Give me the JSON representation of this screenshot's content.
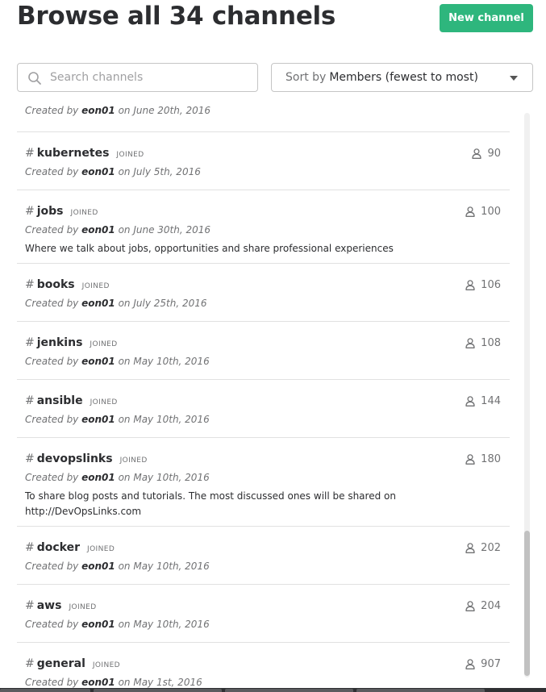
{
  "header": {
    "title": "Browse all 34 channels",
    "new_channel_label": "New channel"
  },
  "search": {
    "placeholder": "Search channels",
    "value": ""
  },
  "sort": {
    "label": "Sort by",
    "value": "Members (fewest to most)"
  },
  "partial_row": {
    "created_prefix": "Created by",
    "creator": "eon01",
    "created_suffix": "on June 20th, 2016"
  },
  "channels": [
    {
      "name": "kubernetes",
      "status": "JOINED",
      "creator": "eon01",
      "date": "on July 5th, 2016",
      "purpose": "",
      "members": "90"
    },
    {
      "name": "jobs",
      "status": "JOINED",
      "creator": "eon01",
      "date": "on June 30th, 2016",
      "purpose": "Where we talk about jobs, opportunities and share  professional experiences",
      "members": "100"
    },
    {
      "name": "books",
      "status": "JOINED",
      "creator": "eon01",
      "date": "on July 25th, 2016",
      "purpose": "",
      "members": "106"
    },
    {
      "name": "jenkins",
      "status": "JOINED",
      "creator": "eon01",
      "date": "on May 10th, 2016",
      "purpose": "",
      "members": "108"
    },
    {
      "name": "ansible",
      "status": "JOINED",
      "creator": "eon01",
      "date": "on May 10th, 2016",
      "purpose": "",
      "members": "144"
    },
    {
      "name": "devopslinks",
      "status": "JOINED",
      "creator": "eon01",
      "date": "on May 10th, 2016",
      "purpose": "To share blog posts and tutorials. The most discussed ones will be shared on http://DevOpsLinks.com",
      "members": "180"
    },
    {
      "name": "docker",
      "status": "JOINED",
      "creator": "eon01",
      "date": "on May 10th, 2016",
      "purpose": "",
      "members": "202"
    },
    {
      "name": "aws",
      "status": "JOINED",
      "creator": "eon01",
      "date": "on May 10th, 2016",
      "purpose": "",
      "members": "204"
    },
    {
      "name": "general",
      "status": "JOINED",
      "creator": "eon01",
      "date": "on May 1st, 2016",
      "purpose": "",
      "members": "907"
    }
  ],
  "labels": {
    "hash": "#",
    "created_by": "Created by"
  },
  "colors": {
    "accent": "#2eb67d",
    "text": "#2c2d30",
    "muted": "#717274",
    "divider": "#e1e1e1"
  },
  "icons": {
    "search": "search-icon",
    "members": "person-icon",
    "sort_caret": "caret-down-icon"
  }
}
